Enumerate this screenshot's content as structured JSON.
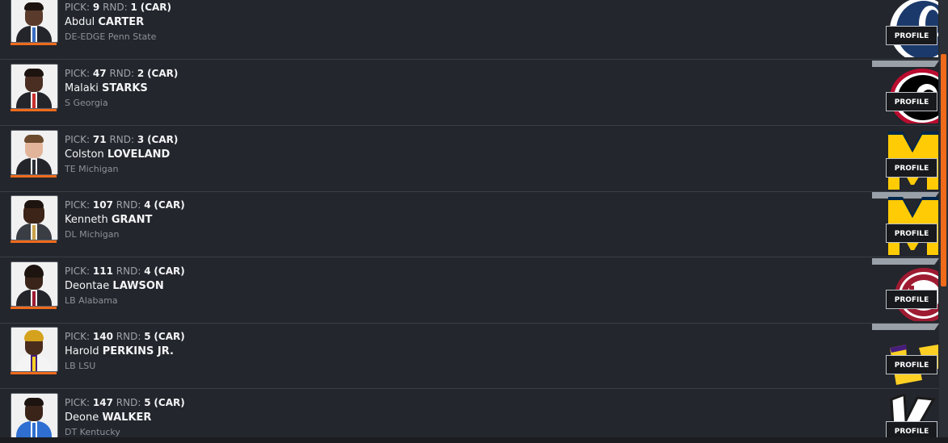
{
  "colors": {
    "accent": "#ef6a1b",
    "background": "#23262c"
  },
  "profile_label": "PROFILE",
  "labels": {
    "pick": "PICK:",
    "rnd": "RND:"
  },
  "picks": [
    {
      "pick": "9",
      "round": "1",
      "team": "(CAR)",
      "first": "Abdul",
      "last": "CARTER",
      "info": "DE-EDGE Penn State",
      "logo_icon": "penn-state-logo-icon"
    },
    {
      "pick": "47",
      "round": "2",
      "team": "(CAR)",
      "first": "Malaki",
      "last": "STARKS",
      "info": "S Georgia",
      "logo_icon": "georgia-logo-icon"
    },
    {
      "pick": "71",
      "round": "3",
      "team": "(CAR)",
      "first": "Colston",
      "last": "LOVELAND",
      "info": "TE Michigan",
      "logo_icon": "michigan-logo-icon"
    },
    {
      "pick": "107",
      "round": "4",
      "team": "(CAR)",
      "first": "Kenneth",
      "last": "GRANT",
      "info": "DL Michigan",
      "logo_icon": "michigan-logo-icon"
    },
    {
      "pick": "111",
      "round": "4",
      "team": "(CAR)",
      "first": "Deontae",
      "last": "LAWSON",
      "info": "LB Alabama",
      "logo_icon": "alabama-logo-icon"
    },
    {
      "pick": "140",
      "round": "5",
      "team": "(CAR)",
      "first": "Harold",
      "last": "PERKINS JR.",
      "info": "LB LSU",
      "logo_icon": "lsu-logo-icon"
    },
    {
      "pick": "147",
      "round": "5",
      "team": "(CAR)",
      "first": "Deone",
      "last": "WALKER",
      "info": "DT Kentucky",
      "logo_icon": "kentucky-logo-icon"
    }
  ]
}
